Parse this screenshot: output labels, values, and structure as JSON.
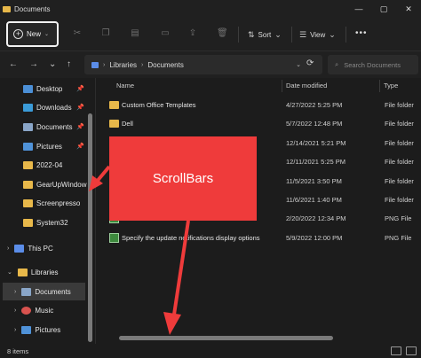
{
  "window": {
    "title": "Documents",
    "controls": [
      "—",
      "▢",
      "✕"
    ]
  },
  "toolbar": {
    "new_label": "New",
    "sort_label": "Sort",
    "view_label": "View",
    "more_label": "•••",
    "icons": [
      "cut-icon",
      "copy-icon",
      "paste-icon",
      "rename-icon",
      "share-icon",
      "delete-icon"
    ]
  },
  "address": {
    "back": "←",
    "forward": "→",
    "recent": "⌄",
    "up": "↑",
    "crumbs": [
      "Libraries",
      "Documents"
    ],
    "search_placeholder": "Search Documents"
  },
  "sidebar": {
    "quick": [
      {
        "label": "Desktop",
        "color": "#4b8fd6",
        "pinned": true
      },
      {
        "label": "Downloads",
        "color": "#3b9bd8",
        "pinned": true
      },
      {
        "label": "Documents",
        "color": "#8aa6c8",
        "pinned": true
      },
      {
        "label": "Pictures",
        "color": "#4f92d8",
        "pinned": true
      },
      {
        "label": "2022-04",
        "color": "#e8b84a",
        "pinned": false
      },
      {
        "label": "GearUpWindow",
        "color": "#e8b84a",
        "pinned": false
      },
      {
        "label": "Screenpresso",
        "color": "#e8b84a",
        "pinned": false
      },
      {
        "label": "System32",
        "color": "#e8b84a",
        "pinned": false
      }
    ],
    "this_pc": "This PC",
    "libraries": "Libraries",
    "lib_items": [
      {
        "label": "Documents",
        "color": "#8aa6c8"
      },
      {
        "label": "Music",
        "color": "#d9534f"
      },
      {
        "label": "Pictures",
        "color": "#4f92d8"
      }
    ]
  },
  "columns": {
    "name": "Name",
    "date": "Date modified",
    "type": "Type"
  },
  "files": [
    {
      "name": "Custom Office Templates",
      "date": "4/27/2022 5:25 PM",
      "type": "File folder",
      "kind": "folder"
    },
    {
      "name": "Dell",
      "date": "5/7/2022 12:48 PM",
      "type": "File folder",
      "kind": "folder"
    },
    {
      "name": "",
      "date": "12/14/2021 5:21 PM",
      "type": "File folder",
      "kind": "folder"
    },
    {
      "name": "",
      "date": "12/11/2021 5:25 PM",
      "type": "File folder",
      "kind": "folder"
    },
    {
      "name": "",
      "date": "11/5/2021 3:50 PM",
      "type": "File folder",
      "kind": "folder"
    },
    {
      "name": "",
      "date": "11/6/2021 1:40 PM",
      "type": "File folder",
      "kind": "folder"
    },
    {
      "name": "",
      "date": "2/20/2022 12:34 PM",
      "type": "PNG File",
      "kind": "png"
    },
    {
      "name": "Specify the update notifications display options",
      "date": "5/9/2022 12:00 PM",
      "type": "PNG File",
      "kind": "png"
    }
  ],
  "status": {
    "count": "8 items"
  },
  "callout": {
    "label": "ScrollBars",
    "color": "#ef3b3b"
  }
}
